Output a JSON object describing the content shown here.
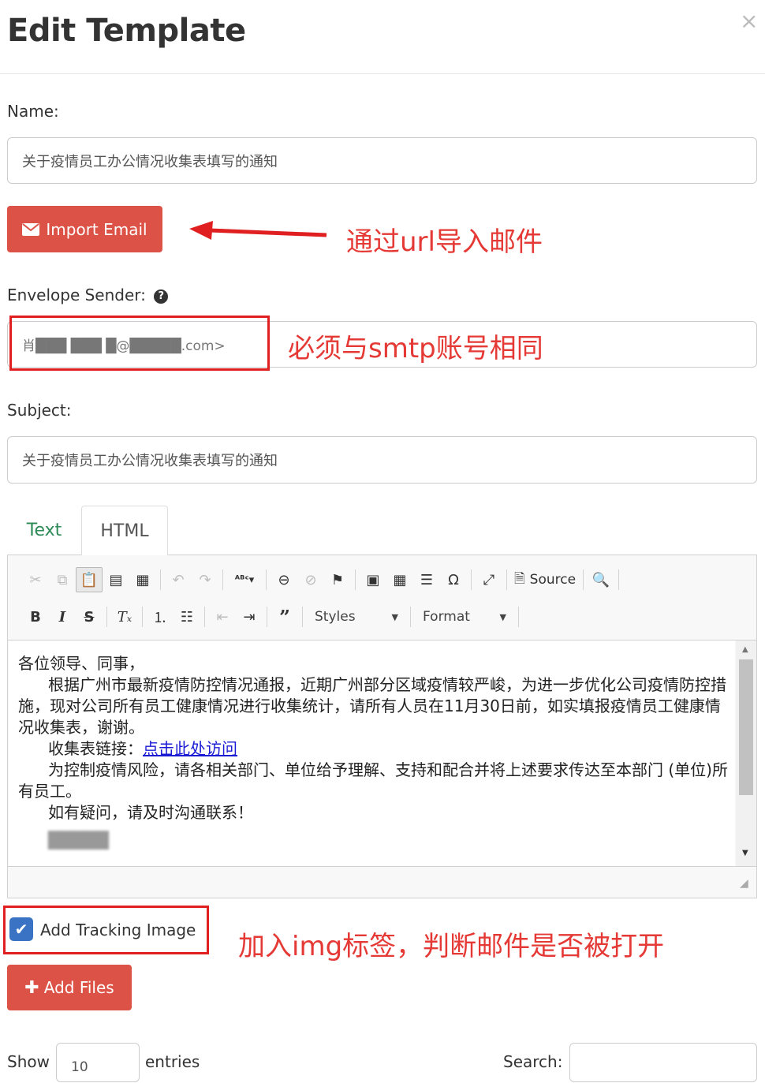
{
  "modal": {
    "title": "Edit Template",
    "close": "×"
  },
  "name": {
    "label": "Name:",
    "value": "关于疫情员工办公情况收集表填写的通知"
  },
  "import_button": {
    "label": "Import Email"
  },
  "annotations": {
    "import": "通过url导入邮件",
    "sender": "必须与smtp账号相同",
    "tracking": "加入img标签，判断邮件是否被打开"
  },
  "sender": {
    "label": "Envelope Sender:",
    "help": "?",
    "value": "肖███ ███ █@█████.com>"
  },
  "subject": {
    "label": "Subject:",
    "value": "关于疫情员工办公情况收集表填写的通知"
  },
  "tabs": [
    {
      "label": "Text"
    },
    {
      "label": "HTML"
    }
  ],
  "toolbar": {
    "source_label": "Source",
    "styles_label": "Styles",
    "format_label": "Format"
  },
  "body": {
    "line1": "各位领导、同事，",
    "line2": "根据广州市最新疫情防控情况通报，近期广州部分区域疫情较严峻，为进一步优化公司疫情防控措施，现对公司所有员工健康情况进行收集统计，请所有人员在11月30日前，如实填报疫情员工健康情况收集表，谢谢。",
    "line3_prefix": "收集表链接：",
    "line3_link": "点击此处访问",
    "line4": "为控制疫情风险，请各相关部门、单位给予理解、支持和配合并将上述要求传达至本部门 (单位)所有员工。",
    "line5": "如有疑问，请及时沟通联系！",
    "signature": "█████"
  },
  "tracking": {
    "label": "Add Tracking Image",
    "checked": true
  },
  "add_files": {
    "label": "Add Files"
  },
  "table_controls": {
    "show_label": "Show",
    "entries_value": "10",
    "entries_label": "entries",
    "search_label": "Search:"
  },
  "colors": {
    "primary_red": "#dd5246",
    "annotation_red": "#e53935",
    "checkbox_blue": "#3b73c4",
    "tab_green": "#2e8b57"
  }
}
